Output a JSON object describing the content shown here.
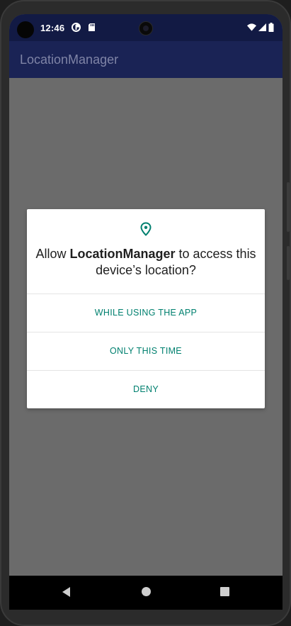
{
  "status_bar": {
    "time": "12:46",
    "icons": [
      "notification-pie-icon",
      "sd-card-icon",
      "wifi-icon",
      "cell-signal-icon",
      "battery-icon"
    ]
  },
  "app_bar": {
    "title": "LocationManager"
  },
  "dialog": {
    "icon": "location-pin-icon",
    "title_prefix": "Allow",
    "title_app": "LocationManager",
    "title_suffix": "to access this device’s location?",
    "options": [
      {
        "label": "WHILE USING THE APP"
      },
      {
        "label": "ONLY THIS TIME"
      },
      {
        "label": "DENY"
      }
    ],
    "accent_color": "#00806f"
  },
  "nav_bar": {
    "buttons": [
      "back-icon",
      "home-icon",
      "recents-icon"
    ]
  }
}
